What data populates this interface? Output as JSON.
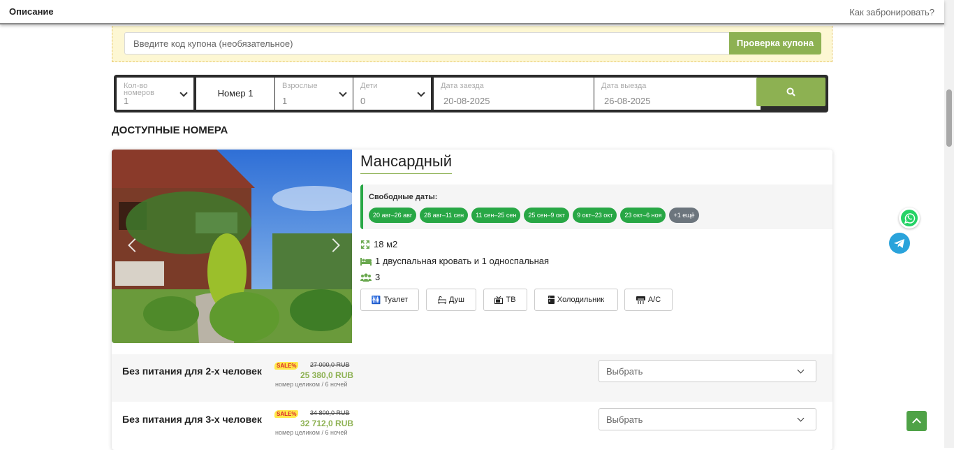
{
  "topbar": {
    "left_title": "Описание",
    "right_link": "Как забронировать?"
  },
  "coupon": {
    "placeholder": "Введите код купона (необязательное)",
    "button": "Проверка купона"
  },
  "search": {
    "rooms_label": "Кол-во номеров",
    "rooms_value": "1",
    "room_tab": "Номер 1",
    "adults_label": "Взрослые",
    "adults_value": "1",
    "children_label": "Дети",
    "children_value": "0",
    "checkin_label": "Дата заезда",
    "checkin_value": "20-08-2025",
    "checkout_label": "Дата выезда",
    "checkout_value": "26-08-2025"
  },
  "section_title": "ДОСТУПНЫЕ НОМЕРА",
  "room": {
    "title": "Мансардный",
    "dates_label": "Свободные даты:",
    "dates": [
      "20 авг–26 авг",
      "28 авг–11 сен",
      "11 сен–25 сен",
      "25 сен–9 окт",
      "9 окт–23 окт",
      "23 окт–6 ноя"
    ],
    "more": "+1 ещё",
    "area": "18 м2",
    "beds": "1 двуспальная кровать и 1 односпальная",
    "guests": "3",
    "amenities": [
      "Туалет",
      "Душ",
      "ТВ",
      "Холодильник",
      "A/C"
    ]
  },
  "rates": [
    {
      "name": "Без питания для 2-х человек",
      "sale": "SALE%",
      "old_price": "27 000,0 RUB",
      "new_price": "25 380,0 RUB",
      "per": "номер целиком / 6 ночей",
      "select": "Выбрать"
    },
    {
      "name": "Без питания для 3-х человек",
      "sale": "SALE%",
      "old_price": "34 800,0 RUB",
      "new_price": "32 712,0 RUB",
      "per": "номер целиком / 6 ночей",
      "select": "Выбрать"
    }
  ],
  "colors": {
    "accent": "#8db152",
    "chip": "#28a745",
    "chip_more": "#6c757d",
    "sale_badge": "#ffe94a"
  }
}
